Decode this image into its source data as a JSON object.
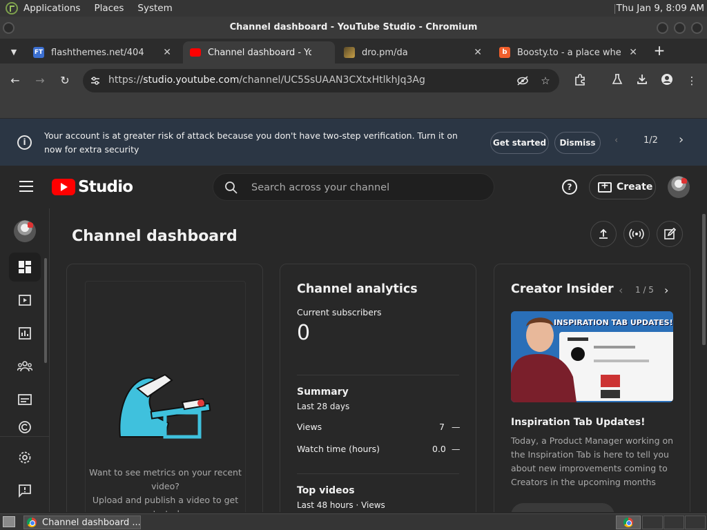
{
  "os": {
    "menu": [
      "Applications",
      "Places",
      "System"
    ],
    "clock": "Thu Jan  9,  8:09 AM"
  },
  "window": {
    "title": "Channel dashboard - YouTube Studio - Chromium"
  },
  "tabs": [
    {
      "label": "flashthemes.net/404",
      "favicon_color": "#3b6fd1"
    },
    {
      "label": "Channel dashboard - YouTube Studio",
      "favicon_color": "#ff0000"
    },
    {
      "label": "dro.pm/da",
      "favicon_color": "#c8a047"
    },
    {
      "label": "Boosty.to - a place where creators",
      "favicon_color": "#f15f2c"
    }
  ],
  "address": {
    "scheme": "https://",
    "host": "studio.youtube.com",
    "path": "/channel/UC5SsUAAN3CXtxHtlkhJq3Ag"
  },
  "banner": {
    "message": "Your account is at greater risk of attack because you don't have two-step verification. Turn it on now for extra security",
    "get_started": "Get started",
    "dismiss": "Dismiss",
    "pager": "1/2"
  },
  "header": {
    "logo_text": "Studio",
    "search_placeholder": "Search across your channel",
    "create_label": "Create"
  },
  "page": {
    "title": "Channel dashboard"
  },
  "upload_card": {
    "message_line1": "Want to see metrics on your recent video?",
    "message_line2": "Upload and publish a video to get started."
  },
  "analytics": {
    "title": "Channel analytics",
    "subscribers_label": "Current subscribers",
    "subscribers_value": "0",
    "summary_title": "Summary",
    "summary_period": "Last 28 days",
    "rows": [
      {
        "label": "Views",
        "value": "7",
        "trend": "—"
      },
      {
        "label": "Watch time (hours)",
        "value": "0.0",
        "trend": "—"
      }
    ],
    "top_videos_title": "Top videos",
    "top_videos_period": "Last 48 hours · Views"
  },
  "insider": {
    "title": "Creator Insider",
    "pager": "1 / 5",
    "thumb_caption": "INSPIRATION TAB UPDATES!",
    "video_title": "Inspiration Tab Updates!",
    "body": "Today, a Product Manager working on the Inspiration Tab is here to tell you about new improvements coming to Creators in the upcoming months"
  },
  "taskbar": {
    "item": "Channel dashboard ..."
  },
  "colors": {
    "accent_red": "#ff0000",
    "banner_bg": "#2b3644",
    "illustration": "#3fc1dd"
  }
}
